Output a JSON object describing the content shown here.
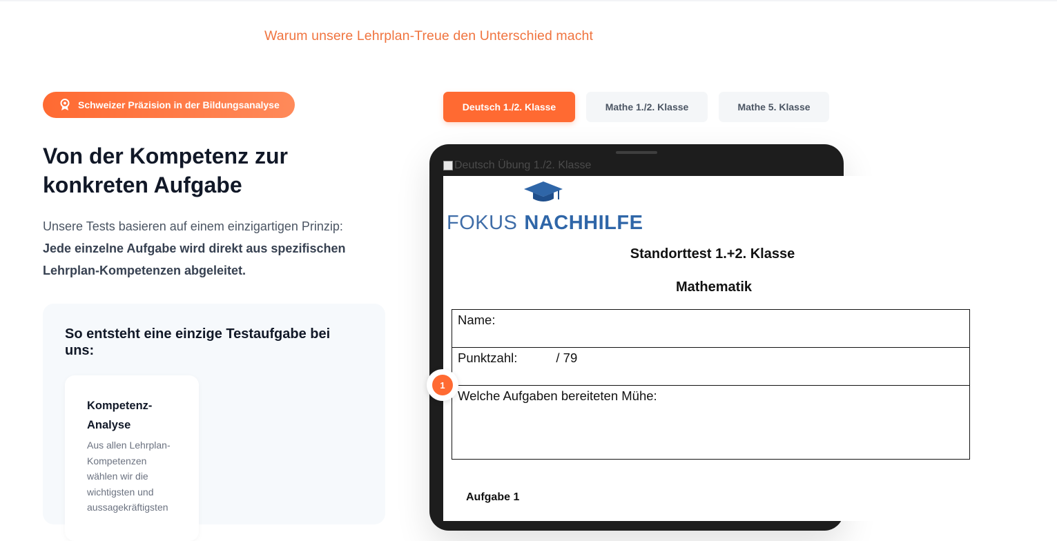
{
  "section": {
    "kicker": "Warum unsere Lehrplan-Treue den Unterschied macht"
  },
  "badge": {
    "icon": "award-icon",
    "label": "Schweizer Präzision in der Bildungsanalyse"
  },
  "headline": "Von der Kompetenz zur konkreten Aufgabe",
  "intro": {
    "text": "Unsere Tests basieren auf einem einzigartigen Prinzip:",
    "highlight": "Jede einzelne Aufgabe wird direkt aus spezifischen Lehrplan-Kompetenzen abgeleitet."
  },
  "steps_card": {
    "title": "So entsteht eine einzige Testaufgabe bei uns:",
    "items": [
      {
        "title": "Kompetenz-Analyse",
        "description": "Aus allen Lehrplan-Kompetenzen wählen wir die wichtigsten und aussagekräftigsten"
      }
    ]
  },
  "tabs": [
    {
      "label": "Deutsch 1./2. Klasse",
      "active": true
    },
    {
      "label": "Mathe 1./2. Klasse",
      "active": false
    },
    {
      "label": "Mathe 5. Klasse",
      "active": false
    }
  ],
  "preview": {
    "image_alt": "Deutsch Übung 1./2. Klasse",
    "logo": {
      "word1": "FOKUS",
      "word2": "NACHHILFE",
      "icon": "graduation-cap-icon"
    },
    "title": "Standorttest 1.+2. Klasse",
    "subject": "Mathematik",
    "form": {
      "name_label": "Name:",
      "points_label": "Punktzahl:",
      "points_value": "/ 79",
      "trouble_label": "Welche Aufgaben bereiteten Mühe:"
    },
    "task_label": "Aufgabe 1",
    "marker_number": "1"
  },
  "colors": {
    "accent": "#ff6a32",
    "kicker": "#f0743f",
    "logo_blue": "#2f66a8"
  }
}
